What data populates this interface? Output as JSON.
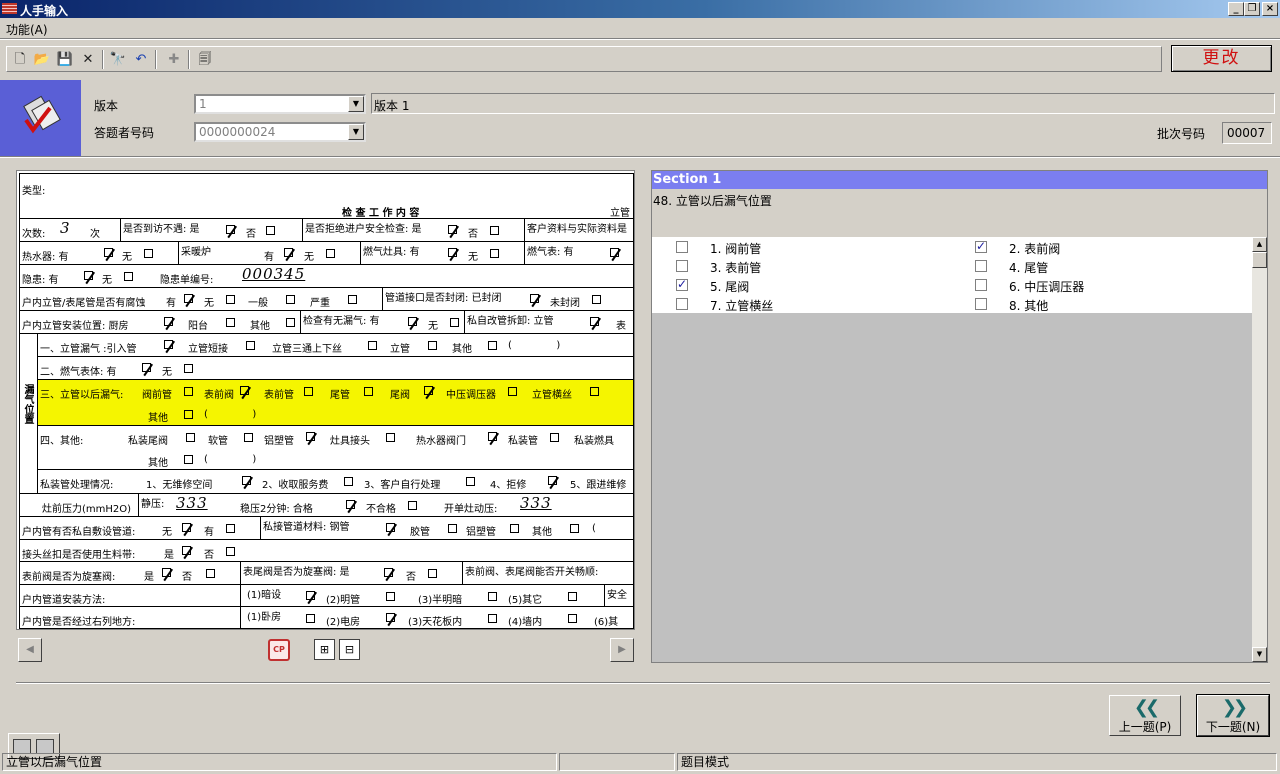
{
  "window": {
    "title": "人手输入",
    "min": "_",
    "restore": "❐",
    "close": "×"
  },
  "menu": {
    "function": "功能(A)"
  },
  "toolbar": {
    "change_label": "更改"
  },
  "header": {
    "version_label": "版本",
    "version_value": "1",
    "version_desc": "版本 1",
    "respondent_label": "答题者号码",
    "respondent_value": "0000000024",
    "batch_label": "批次号码",
    "batch_value": "00007"
  },
  "document": {
    "type_label": "类型:",
    "work_title": "检 查 工 作 内 容",
    "riser": "立管",
    "count_label": "次数:",
    "count_value": "3",
    "count_unit": "次",
    "visit_fail": "是否到访不遇: 是",
    "no": "否",
    "refuse": "是否拒绝进户安全检查: 是",
    "mismatch": "客户资料与实际资料是",
    "water_heater": "热水器: 有",
    "none": "无",
    "heater": "采暖炉",
    "has": "有",
    "stove": "燃气灶具: 有",
    "meter": "燃气表: 有",
    "hazard": "隐患: 有",
    "hazard_no_label": "隐患单编号:",
    "hazard_no_value": "000345",
    "corrosion": "户内立管/表尾管是否有腐蚀",
    "general": "一般",
    "serious": "严重",
    "seal": "管道接口是否封闭: 已封闭",
    "unsealed": "未封闭",
    "install_pos": "户内立管安装位置: 厨房",
    "balcony": "阳台",
    "other": "其他",
    "smell": "检查有无漏气: 有",
    "private_dismantle": "私自改管拆卸: 立管",
    "meter_short": "表",
    "leak_group": "漏气位置",
    "l1": "一、立管漏气 :引入管",
    "l1b": "立管短接",
    "l1c": "立管三通上下丝",
    "l1d": "立管",
    "l1e": "其他",
    "l2": "二、燃气表体: 有",
    "l3": "三、立管以后漏气:",
    "l3a": "阀前管",
    "l3b": "表前阀",
    "l3c": "表前管",
    "l3d": "尾管",
    "l3e": "尾阀",
    "l3f": "中压调压器",
    "l3g": "立管横丝",
    "l4": "四、其他:",
    "l4a": "私装尾阀",
    "l4b": "软管",
    "l4c": "铝塑管",
    "l4d": "灶具接头",
    "l4e": "热水器阀门",
    "l4f": "私装管",
    "l4g": "私装燃具",
    "private_handle": "私装管处理情况:",
    "ph1": "1、无维修空间",
    "ph2": "2、收取服务费",
    "ph3": "3、客户自行处理",
    "ph4": "4、拒修",
    "ph5": "5、跟进维修",
    "pressure": "灶前压力(mmH2O)",
    "static_label": "静压:",
    "static_value": "333",
    "steady": "稳压2分钟: 合格",
    "unqualified": "不合格",
    "open_pressure": "开单灶动压:",
    "open_value": "333",
    "private_pipe": "户内管有否私自敷设管道:",
    "pipe_mat": "私接管道材料: 钢管",
    "rubber": "胶管",
    "al_plastic": "铝塑管",
    "joint": "接头丝扣是否使用生料带:",
    "yes": "是",
    "front_valve": "表前阀是否为旋塞阀:",
    "tail_valve": "表尾阀是否为旋塞阀: 是",
    "valve_open": "表前阀、表尾阀能否开关畅顺:",
    "install_method": "户内管道安装方法:",
    "m1": "(1)暗设",
    "m2": "(2)明管",
    "m3": "(3)半明暗",
    "m5": "(5)其它",
    "safety": "安全",
    "pass_through": "户内管是否经过右列地方:",
    "p1": "(1)卧房",
    "p2": "(2)电房",
    "p3": "(3)天花板内",
    "p4": "(4)墙内",
    "p6": "(6)其"
  },
  "question": {
    "section": "Section 1",
    "text": "48. 立管以后漏气位置",
    "options": [
      {
        "label": "1. 阀前管",
        "checked": false
      },
      {
        "label": "2. 表前阀",
        "checked": true
      },
      {
        "label": "3. 表前管",
        "checked": false
      },
      {
        "label": "4. 尾管",
        "checked": false
      },
      {
        "label": "5. 尾阀",
        "checked": true
      },
      {
        "label": "6. 中压调压器",
        "checked": false
      },
      {
        "label": "7. 立管横丝",
        "checked": false
      },
      {
        "label": "8. 其他",
        "checked": false
      }
    ]
  },
  "nav": {
    "prev": "上一题(P)",
    "next": "下一题(N)"
  },
  "status": {
    "left": "立管以后漏气位置",
    "mode": "题目模式"
  },
  "colors": {
    "section_header": "#7b7ef0",
    "highlight": "#f5f500",
    "change_text": "#d01010"
  }
}
